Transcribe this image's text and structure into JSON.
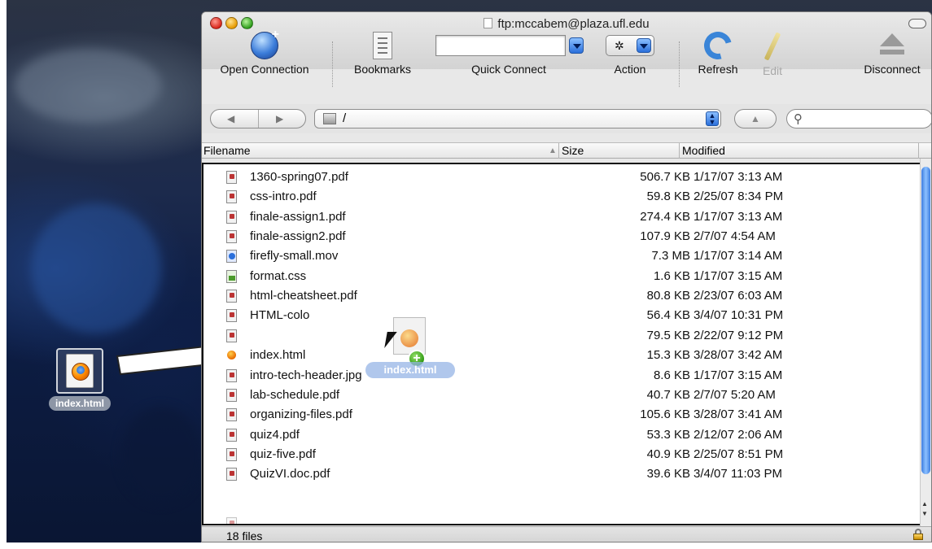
{
  "window": {
    "title": "ftp:mccabem@plaza.ufl.edu"
  },
  "toolbar": {
    "open_connection": "Open Connection",
    "bookmarks": "Bookmarks",
    "quick_connect": "Quick Connect",
    "action": "Action",
    "refresh": "Refresh",
    "edit": "Edit",
    "disconnect": "Disconnect",
    "quick_connect_value": ""
  },
  "navbar": {
    "path": "/",
    "search_value": ""
  },
  "columns": {
    "filename": "Filename",
    "size": "Size",
    "modified": "Modified"
  },
  "files": [
    {
      "name": "1360-spring07.pdf",
      "size": "506.7 KB",
      "modified": "1/17/07 3:13 AM",
      "icon": "pdf-icon"
    },
    {
      "name": "css-intro.pdf",
      "size": "59.8 KB",
      "modified": "2/25/07 8:34 PM",
      "icon": "pdf-icon"
    },
    {
      "name": "finale-assign1.pdf",
      "size": "274.4 KB",
      "modified": "1/17/07 3:13 AM",
      "icon": "pdf-icon"
    },
    {
      "name": "finale-assign2.pdf",
      "size": "107.9 KB",
      "modified": "2/7/07 4:54 AM",
      "icon": "pdf-icon"
    },
    {
      "name": "firefly-small.mov",
      "size": "7.3 MB",
      "modified": "1/17/07 3:14 AM",
      "icon": "movie-icon"
    },
    {
      "name": "format.css",
      "size": "1.6 KB",
      "modified": "1/17/07 3:15 AM",
      "icon": "css-icon"
    },
    {
      "name": "html-cheatsheet.pdf",
      "size": "80.8 KB",
      "modified": "2/23/07 6:03 AM",
      "icon": "pdf-icon"
    },
    {
      "name": "HTML-colo",
      "size": "56.4 KB",
      "modified": "3/4/07 10:31 PM",
      "icon": "pdf-icon"
    },
    {
      "name": "",
      "size": "79.5 KB",
      "modified": "2/22/07 9:12 PM",
      "icon": "pdf-icon"
    },
    {
      "name": "index.html",
      "size": "15.3 KB",
      "modified": "3/28/07 3:42 AM",
      "icon": "html-icon"
    },
    {
      "name": "intro-tech-header.jpg",
      "size": "8.6 KB",
      "modified": "1/17/07 3:15 AM",
      "icon": "image-icon"
    },
    {
      "name": "lab-schedule.pdf",
      "size": "40.7 KB",
      "modified": "2/7/07 5:20 AM",
      "icon": "pdf-icon"
    },
    {
      "name": "organizing-files.pdf",
      "size": "105.6 KB",
      "modified": "3/28/07 3:41 AM",
      "icon": "pdf-icon"
    },
    {
      "name": "quiz4.pdf",
      "size": "53.3 KB",
      "modified": "2/12/07 2:06 AM",
      "icon": "pdf-icon"
    },
    {
      "name": "quiz-five.pdf",
      "size": "40.9 KB",
      "modified": "2/25/07 8:51 PM",
      "icon": "pdf-icon"
    },
    {
      "name": "QuizVI.doc.pdf",
      "size": "39.6 KB",
      "modified": "3/4/07 11:03 PM",
      "icon": "pdf-icon"
    }
  ],
  "status": {
    "text": "18 files"
  },
  "desktop": {
    "file_label": "index.html"
  },
  "drag": {
    "label": "index.html"
  }
}
